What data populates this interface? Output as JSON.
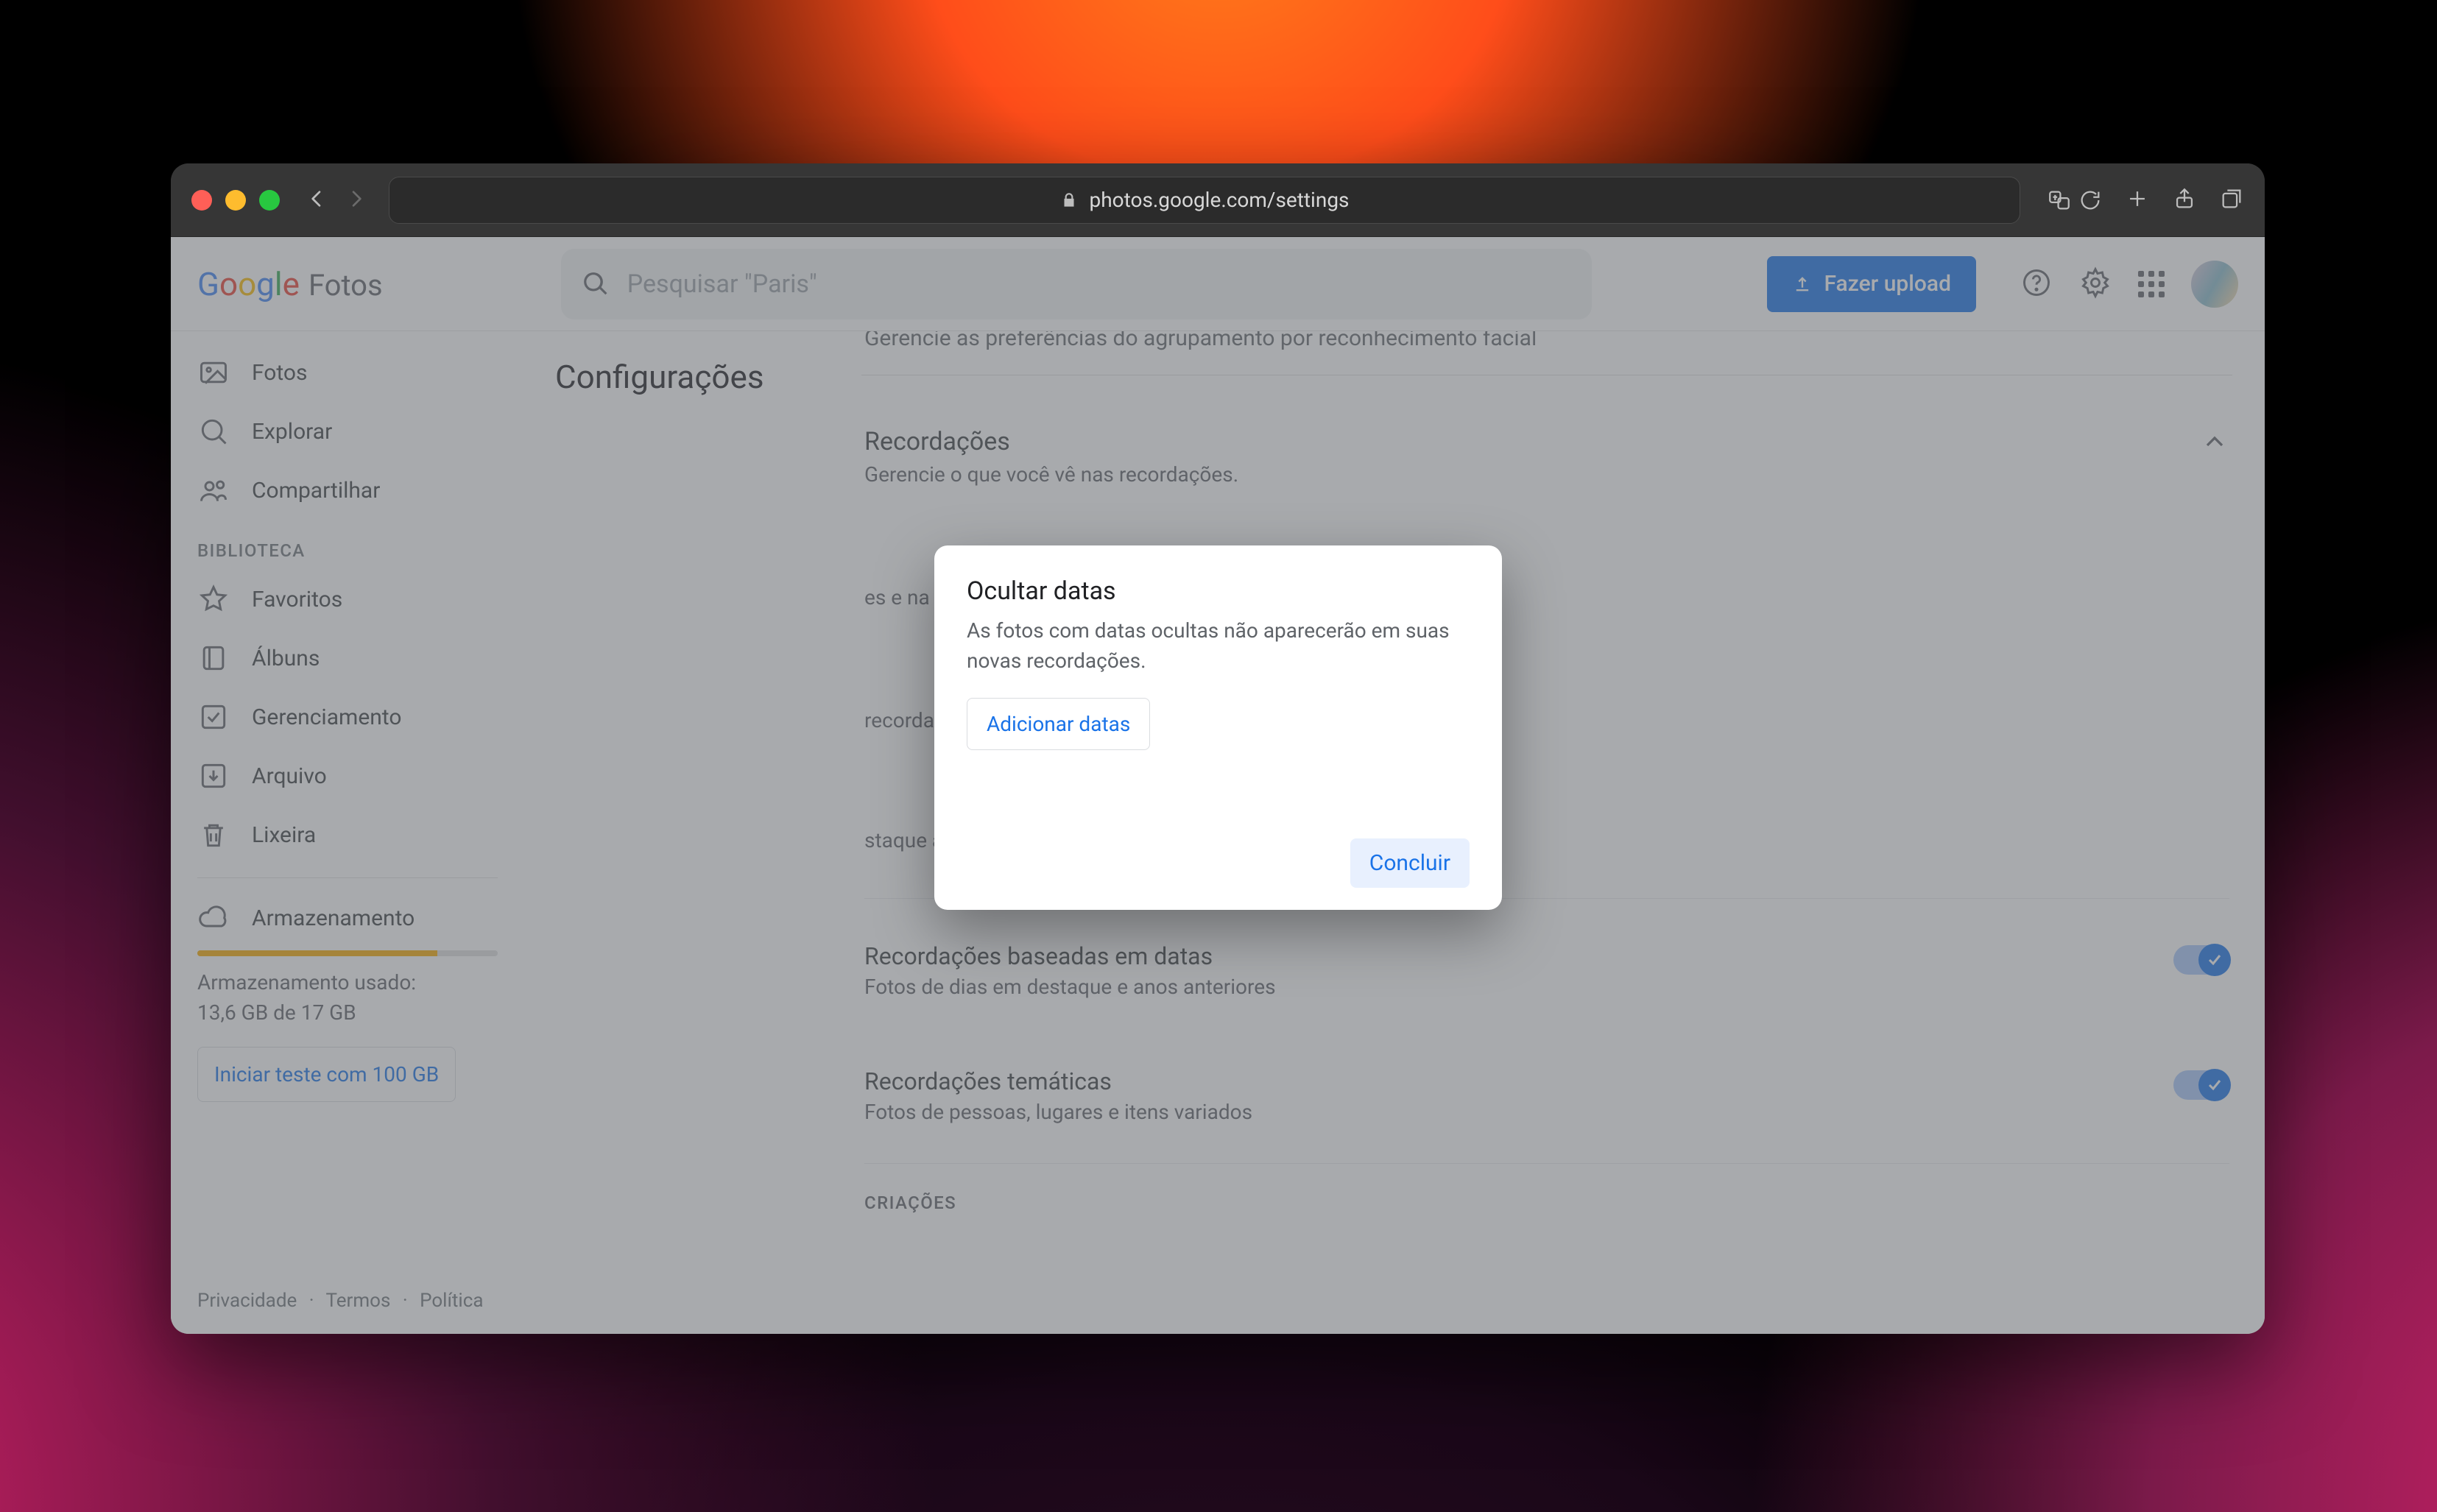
{
  "browser": {
    "url": "photos.google.com/settings"
  },
  "app": {
    "logo_photos": "Fotos",
    "search_placeholder": "Pesquisar \"Paris\"",
    "upload_label": "Fazer upload"
  },
  "sidebar": {
    "items": [
      {
        "label": "Fotos"
      },
      {
        "label": "Explorar"
      },
      {
        "label": "Compartilhar"
      }
    ],
    "section_label": "BIBLIOTECA",
    "library": [
      {
        "label": "Favoritos"
      },
      {
        "label": "Álbuns"
      },
      {
        "label": "Gerenciamento"
      },
      {
        "label": "Arquivo"
      },
      {
        "label": "Lixeira"
      }
    ],
    "storage_label": "Armazenamento",
    "storage_used_label": "Armazenamento usado:",
    "storage_used_value": "13,6 GB de 17 GB",
    "storage_fill_pct": 80,
    "trial_label": "Iniciar teste com 100 GB"
  },
  "footer": {
    "privacy": "Privacidade",
    "terms": "Termos",
    "policy": "Política"
  },
  "content": {
    "page_title": "Configurações",
    "faint_row": "Gerencie as preferências do agrupamento por reconhecimento facial",
    "memories": {
      "title": "Recordações",
      "subtitle": "Gerencie o que você vê nas recordações."
    },
    "row_search": {
      "title_tail": "es e na sua página de pesquisa."
    },
    "row_hide_mem": {
      "title_tail": "recordações."
    },
    "row_highlight": {
      "title_tail": "staque acima da sua visualização"
    },
    "row_date_based": {
      "title": "Recordações baseadas em datas",
      "subtitle": "Fotos de dias em destaque e anos anteriores"
    },
    "row_thematic": {
      "title": "Recordações temáticas",
      "subtitle": "Fotos de pessoas, lugares e itens variados"
    },
    "creations_header": "CRIAÇÕES"
  },
  "dialog": {
    "title": "Ocultar datas",
    "body": "As fotos com datas ocultas não aparecerão em suas novas recordações.",
    "add_label": "Adicionar datas",
    "done_label": "Concluir"
  }
}
